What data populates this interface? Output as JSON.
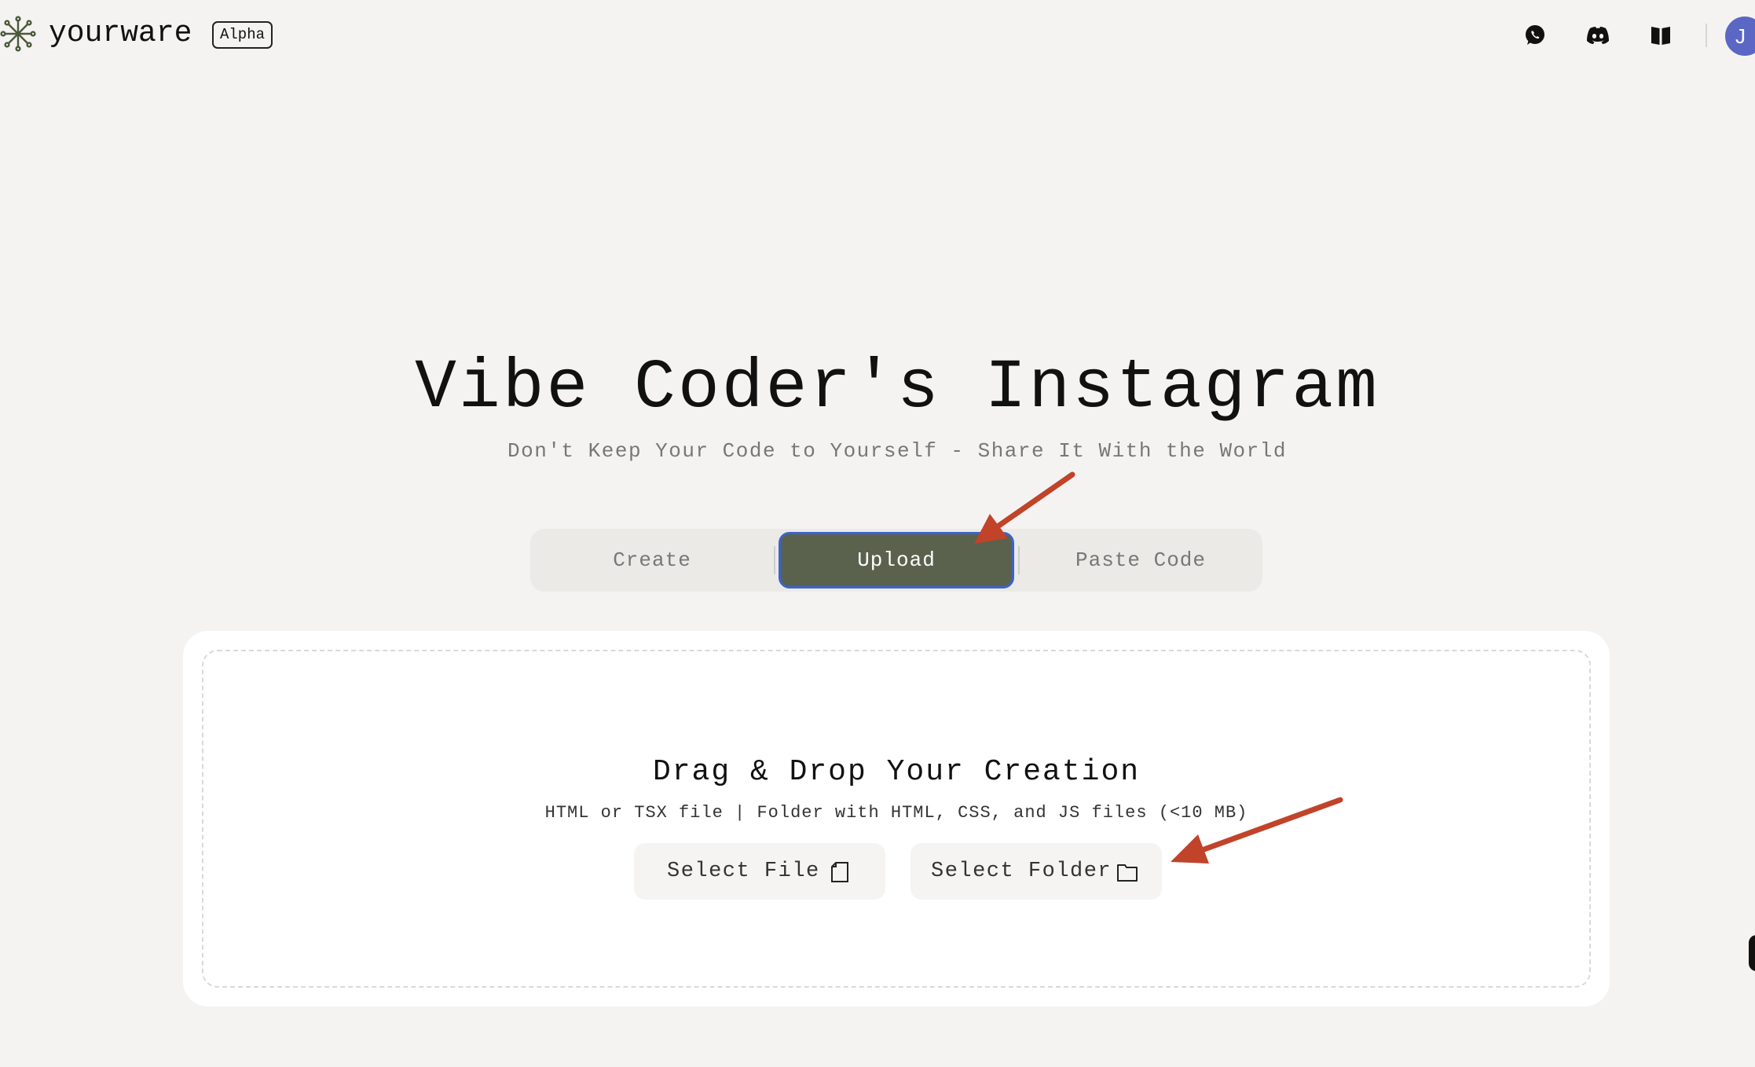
{
  "header": {
    "brand": "yourware",
    "badge": "Alpha",
    "icons": [
      "whatsapp-icon",
      "discord-icon",
      "book-icon"
    ],
    "avatar_initial": "J"
  },
  "hero": {
    "title": "Vibe Coder's Instagram",
    "subtitle": "Don't Keep Your Code to Yourself - Share It With the World"
  },
  "tabs": [
    {
      "label": "Create",
      "active": false
    },
    {
      "label": "Upload",
      "active": true
    },
    {
      "label": "Paste Code",
      "active": false
    }
  ],
  "upload": {
    "title": "Drag & Drop Your Creation",
    "description": "HTML or TSX file | Folder with HTML, CSS, and JS files (<10 MB)",
    "select_file_label": "Select File",
    "select_folder_label": "Select Folder"
  },
  "colors": {
    "background": "#f4f3f1",
    "active_tab": "#5a624d",
    "active_tab_border": "#3d63c9",
    "avatar": "#5b67c4",
    "annotation_arrow": "#c0432a"
  }
}
